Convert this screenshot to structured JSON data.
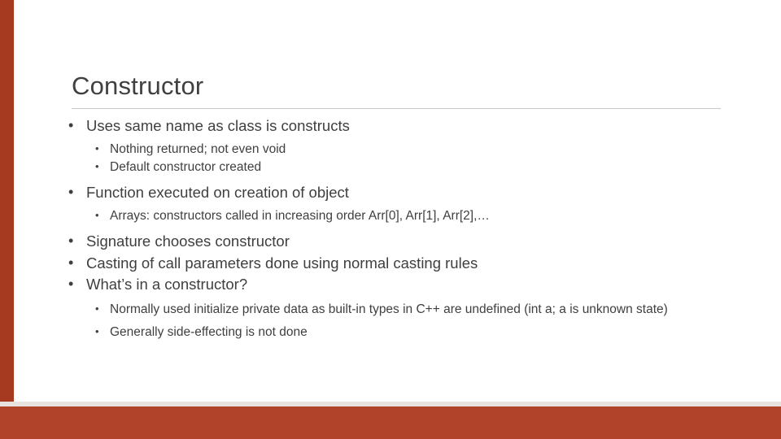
{
  "slide": {
    "title": "Constructor",
    "colors": {
      "accent_bar": "#b0432a",
      "left_bar": "#a63a21",
      "text": "#3f3f3f",
      "rule": "#c8c8c8"
    },
    "bullets": [
      {
        "level": 1,
        "text": "Uses same name as class is constructs"
      },
      {
        "level": 2,
        "text": "Nothing returned; not even void"
      },
      {
        "level": 2,
        "text": "Default constructor created"
      },
      {
        "level": 1,
        "text": "Function executed on creation of object"
      },
      {
        "level": 2,
        "text": "Arrays:  constructors called in increasing order Arr[0], Arr[1], Arr[2],…"
      },
      {
        "level": 1,
        "text": "Signature chooses constructor"
      },
      {
        "level": 1,
        "text": "Casting of call parameters done using normal casting rules"
      },
      {
        "level": 1,
        "text": "What’s in a constructor?"
      },
      {
        "level": 2,
        "text": "Normally used initialize private data as built-in types in C++ are undefined (int a;  a is unknown state)"
      },
      {
        "level": 2,
        "text": "Generally side-effecting is not done"
      }
    ],
    "bullet_marks": {
      "level1": "•",
      "level2": "•"
    }
  }
}
